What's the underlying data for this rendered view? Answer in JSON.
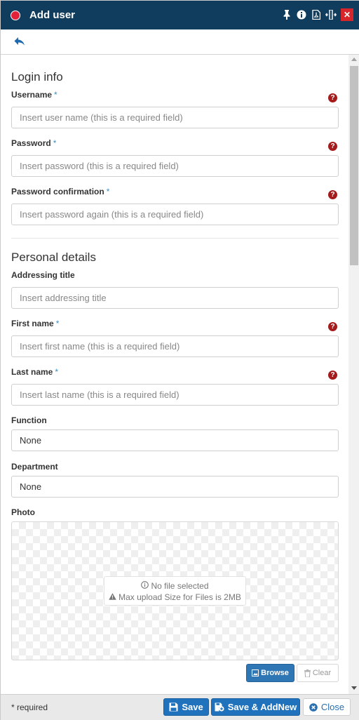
{
  "window": {
    "title": "Add user"
  },
  "sections": {
    "login_info": "Login info",
    "personal_details": "Personal details"
  },
  "fields": {
    "username": {
      "label": "Username",
      "required_mark": "*",
      "placeholder": "Insert user name (this is a required field)"
    },
    "password": {
      "label": "Password",
      "required_mark": "*",
      "placeholder": "Insert password (this is a required field)"
    },
    "password_confirmation": {
      "label": "Password confirmation",
      "required_mark": "*",
      "placeholder": "Insert password again (this is a required field)"
    },
    "addressing_title": {
      "label": "Addressing title",
      "placeholder": "Insert addressing title"
    },
    "first_name": {
      "label": "First name",
      "required_mark": "*",
      "placeholder": "Insert first name (this is a required field)"
    },
    "last_name": {
      "label": "Last name",
      "required_mark": "*",
      "placeholder": "Insert last name (this is a required field)"
    },
    "function": {
      "label": "Function",
      "value": "None"
    },
    "department": {
      "label": "Department",
      "value": "None"
    },
    "photo": {
      "label": "Photo",
      "no_file": "No file selected",
      "max_size": "Max upload Size for Files is 2MB",
      "browse_label": "Browse",
      "clear_label": "Clear"
    }
  },
  "footer": {
    "required_note": "* required",
    "save_label": "Save",
    "save_addnew_label": "Save & AddNew",
    "close_label": "Close"
  },
  "colors": {
    "titlebar": "#103d5d",
    "primary_button": "#1f72bb",
    "help_icon": "#a51a1a",
    "required_star": "#3b8fc4"
  },
  "icons": {
    "title": "record-dot-icon",
    "toolbar": [
      "pin-icon",
      "info-icon",
      "pdf-icon",
      "resize-icon",
      "close-icon"
    ],
    "back": "reply-arrow-icon",
    "help": "question-circle-icon"
  }
}
